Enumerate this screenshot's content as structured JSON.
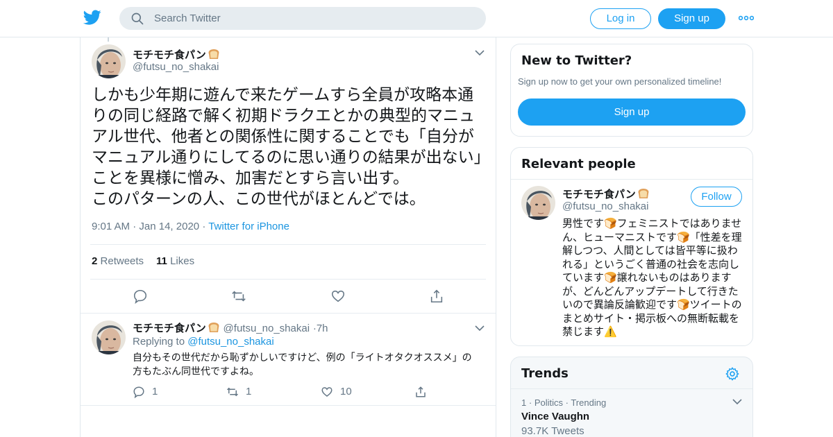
{
  "colors": {
    "accent": "#1da1f2",
    "link": "#1b95e0",
    "muted": "#657786",
    "text": "#14171a",
    "border": "#e1e8ed"
  },
  "header": {
    "logo_icon": "twitter-bird-icon",
    "search_placeholder": "Search Twitter",
    "login_label": "Log in",
    "signup_label": "Sign up",
    "more_icon": "more-dots-icon"
  },
  "tweet": {
    "author_name": "モチモチ食パン",
    "author_handle": "@futsu_no_shakai",
    "emoji_icon": "bread-emoji-icon",
    "text": "しかも少年期に遊んで来たゲームすら全員が攻略本通りの同じ経路で解く初期ドラクエとかの典型的マニュアル世代、他者との関係性に関することでも「自分がマニュアル通りにしてるのに思い通りの結果が出ない」ことを異様に憎み、加害だとすら言い出す。\nこのパターンの人、この世代がほとんどでは。",
    "time": "9:01 AM",
    "date": "Jan 14, 2020",
    "source": "Twitter for iPhone",
    "retweets_count": "2",
    "retweets_label": "Retweets",
    "likes_count": "11",
    "likes_label": "Likes"
  },
  "reply": {
    "author_name": "モチモチ食パン",
    "author_handle": "@futsu_no_shakai",
    "age": "7h",
    "replying_prefix": "Replying to",
    "replying_to": "@futsu_no_shakai",
    "text": "自分もその世代だから恥ずかしいですけど、例の「ライトオタクオススメ」の方もたぶん同世代ですよね。",
    "reply_count": "1",
    "retweet_count": "1",
    "like_count": "10"
  },
  "sidebar": {
    "new_title": "New to Twitter?",
    "new_subtitle": "Sign up now to get your own personalized timeline!",
    "new_signup": "Sign up",
    "relevant_title": "Relevant people",
    "person_name": "モチモチ食パン",
    "person_handle": "@futsu_no_shakai",
    "follow_label": "Follow",
    "person_bio": "男性です🍞フェミニストではありません、ヒューマニストです🍞「性差を理解しつつ、人間としては皆平等に扱われる」というごく普通の社会を志向しています🍞譲れないものはありますが、どんどんアップデートして行きたいので異論反論歓迎です🍞ツイートのまとめサイト・掲示板への無断転載を禁じます⚠️",
    "trends_title": "Trends",
    "trend_rank": "1",
    "trend_category": "Politics",
    "trend_status": "Trending",
    "trend_name": "Vince Vaughn",
    "trend_count": "93.7K Tweets"
  }
}
